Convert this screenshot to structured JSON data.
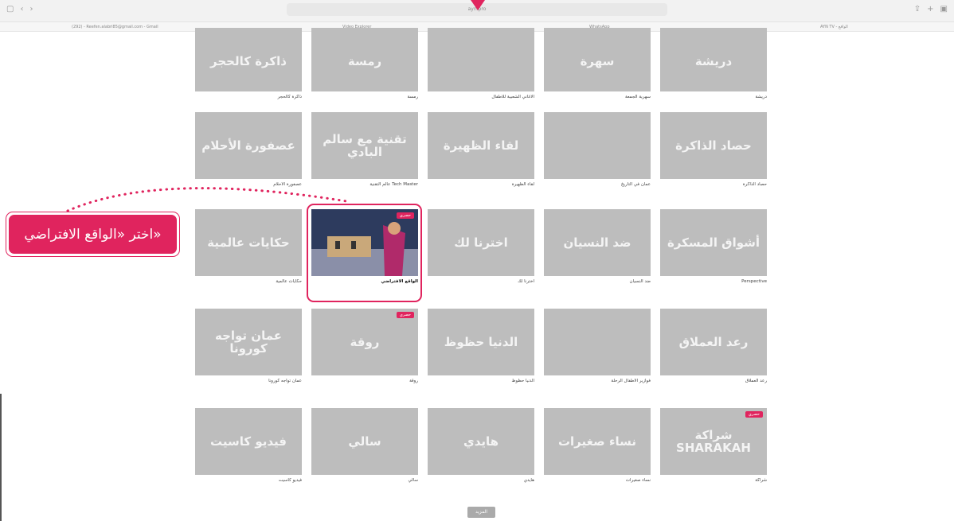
{
  "browser": {
    "url": "ayn.pro",
    "bookmarks": [
      "(292) - Reefen.alabri85@gmail.com - Gmail",
      "Video Explorer",
      "WhatsApp",
      "AYN TV - الواقع"
    ]
  },
  "callout": {
    "text": "اختر «الواقع الافتراضي»"
  },
  "tiles": [
    {
      "caption": "دريشة",
      "art": "دريشة",
      "badge": ""
    },
    {
      "caption": "سهرية الجمعة",
      "art": "سهرة",
      "badge": ""
    },
    {
      "caption": "الأغاني الشعبية للأطفال",
      "art": "",
      "badge": ""
    },
    {
      "caption": "رمسة",
      "art": "رمسة",
      "badge": ""
    },
    {
      "caption": "ذاكرة كالحجر",
      "art": "ذاكرة كالحجر",
      "badge": ""
    },
    {
      "caption": "حصاد الذاكرة",
      "art": "حصاد الذاكرة",
      "badge": ""
    },
    {
      "caption": "عمان في التاريخ",
      "art": "",
      "badge": ""
    },
    {
      "caption": "لقاء الظهيرة",
      "art": "لقاء الظهيرة",
      "badge": ""
    },
    {
      "caption": "عالم التقنية Tech Master",
      "art": "تقنية مع سالم البادي",
      "badge": ""
    },
    {
      "caption": "عصفورة الأحلام",
      "art": "عصفورة الأحلام",
      "badge": ""
    },
    {
      "caption": "Perspective",
      "art": "أشواق المسكرة",
      "badge": ""
    },
    {
      "caption": "ضد النسيان",
      "art": "ضد النسيان",
      "badge": ""
    },
    {
      "caption": "اخترنا لك",
      "art": "اخترنا لك",
      "badge": ""
    },
    {
      "caption": "الواقع الافتراضي",
      "art": "",
      "badge": "حصري"
    },
    {
      "caption": "حكايات عالمية",
      "art": "حكايات عالمية",
      "badge": ""
    },
    {
      "caption": "رعد العملاق",
      "art": "رعد العملاق",
      "badge": ""
    },
    {
      "caption": "فوازير الأطفال الرحلة",
      "art": "",
      "badge": ""
    },
    {
      "caption": "الدنيا حظوظ",
      "art": "الدنيا حظوظ",
      "badge": ""
    },
    {
      "caption": "روقة",
      "art": "روقة",
      "badge": "حصري"
    },
    {
      "caption": "عمان تواجه كورونا",
      "art": "عمان تواجه كورونا",
      "badge": ""
    },
    {
      "caption": "شراكة",
      "art": "شراكة SHARAKAH",
      "badge": "حصري"
    },
    {
      "caption": "نساء صغيرات",
      "art": "نساء صغيرات",
      "badge": ""
    },
    {
      "caption": "هايدي",
      "art": "هايدي",
      "badge": ""
    },
    {
      "caption": "سالي",
      "art": "سالي",
      "badge": ""
    },
    {
      "caption": "فيديو كاسيت",
      "art": "فيديو كاسيت",
      "badge": ""
    }
  ],
  "more_button": "المزيد"
}
